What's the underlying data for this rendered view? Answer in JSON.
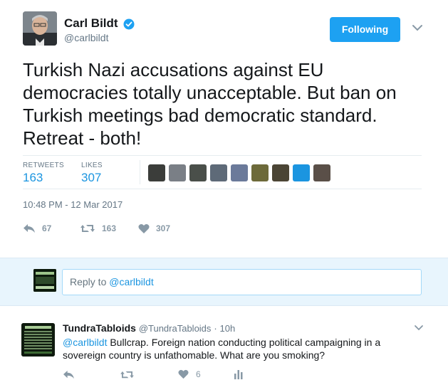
{
  "tweet": {
    "author_name": "Carl Bildt",
    "author_handle": "@carlbildt",
    "follow_label": "Following",
    "text": "Turkish Nazi accusations against EU democracies totally unacceptable. But ban on Turkish meetings bad democratic standard. Retreat - both!",
    "retweets_label": "RETWEETS",
    "retweets_count": "163",
    "likes_label": "LIKES",
    "likes_count": "307",
    "timestamp": "10:48 PM - 12 Mar 2017",
    "actions": {
      "reply_count": "67",
      "retweet_count": "163",
      "like_count": "307"
    },
    "liker_avatar_colors": [
      "#3b3d3a",
      "#7a7f86",
      "#4a4f4a",
      "#5e6a78",
      "#6b7a9a",
      "#6d6a3a",
      "#4b4535",
      "#1b95e0",
      "#5a4f48"
    ]
  },
  "reply_box": {
    "placeholder_prefix": "Reply to",
    "mention": "@carlbildt"
  },
  "reply": {
    "author_name": "TundraTabloids",
    "author_handle": "@TundraTabloids",
    "separator": "·",
    "time": "10h",
    "mention": "@carlbildt",
    "text": "Bullcrap. Foreign nation conducting political campaigning in a sovereign country is unfathomable. What are you smoking?",
    "like_count": "6"
  },
  "colors": {
    "accent": "#1da1f2",
    "link": "#1b95e0",
    "muted": "#657786",
    "reply_bg": "#e8f5fd"
  }
}
